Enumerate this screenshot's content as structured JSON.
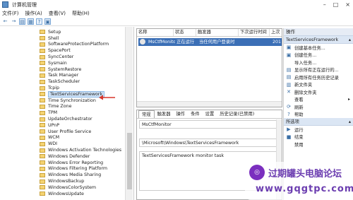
{
  "window": {
    "title": "计算机管理",
    "controls": [
      "–",
      "□",
      "×"
    ]
  },
  "menu": [
    "文件(F)",
    "操作(A)",
    "查看(V)",
    "帮助(H)"
  ],
  "toolbar": [
    "←",
    "→",
    "▤",
    "▦",
    "?",
    "▣"
  ],
  "tree": {
    "items": [
      "Setup",
      "Shell",
      "SoftwareProtectionPlatform",
      "SpacePort",
      "SyncCenter",
      "Sysmain",
      "SystemRestore",
      "Task Manager",
      "TaskScheduler",
      "Tcpip",
      "TextServicesFramework",
      "Time Synchronization",
      "Time Zone",
      "TPM",
      "UpdateOrchestrator",
      "UPnP",
      "User Profile Service",
      "WCM",
      "WDI",
      "Windows Activation Technologies",
      "Windows Defender",
      "Windows Error Reporting",
      "Windows Filtering Platform",
      "Windows Media Sharing",
      "WindowsBackup",
      "WindowsColorSystem",
      "WindowsUpdate"
    ],
    "selected_index": 10
  },
  "grid": {
    "columns": [
      "名称",
      "状态",
      "触发器",
      "下次运行时间",
      "上次"
    ],
    "rows": [
      {
        "name": "MsCtfMonitor",
        "status": "正在运行",
        "trigger": "当任何用户登录时",
        "next": "",
        "last": "201"
      }
    ]
  },
  "detail": {
    "tabs": [
      "常规",
      "触发器",
      "操作",
      "条件",
      "设置",
      "历史记录(已禁用)"
    ],
    "active_tab": 0,
    "name_value": "MsCtfMonitor",
    "location_value": "\\Microsoft\\Windows\\TextServicesFramework",
    "description_value": "TextServicesFramework monitor task"
  },
  "actions": {
    "header": "操作",
    "section1": "TextServicesFramework",
    "items1": [
      {
        "icon": "▣",
        "label": "创建基本任务..."
      },
      {
        "icon": "▣",
        "label": "创建任务..."
      },
      {
        "icon": "",
        "label": "导入任务..."
      },
      {
        "icon": "▤",
        "label": "显示所有正在运行的..."
      },
      {
        "icon": "▤",
        "label": "启用所有任务历史记录"
      },
      {
        "icon": "▥",
        "label": "新文件夹"
      },
      {
        "icon": "✕",
        "label": "删除文件夹"
      },
      {
        "icon": "",
        "label": "查看",
        "arrow": "▸"
      },
      {
        "icon": "⟳",
        "label": "刷新"
      },
      {
        "icon": "?",
        "label": "帮助"
      }
    ],
    "section2": "所选项",
    "items2": [
      {
        "icon": "▶",
        "label": "运行"
      },
      {
        "icon": "■",
        "label": "结束"
      },
      {
        "icon": "",
        "label": "禁用"
      }
    ]
  },
  "watermark": {
    "line1": "过期罐头电脑论坛",
    "line2": "www.gqgtpc.com"
  },
  "colors": {
    "selection": "#3b6fb6",
    "arrow": "#d9362b"
  }
}
